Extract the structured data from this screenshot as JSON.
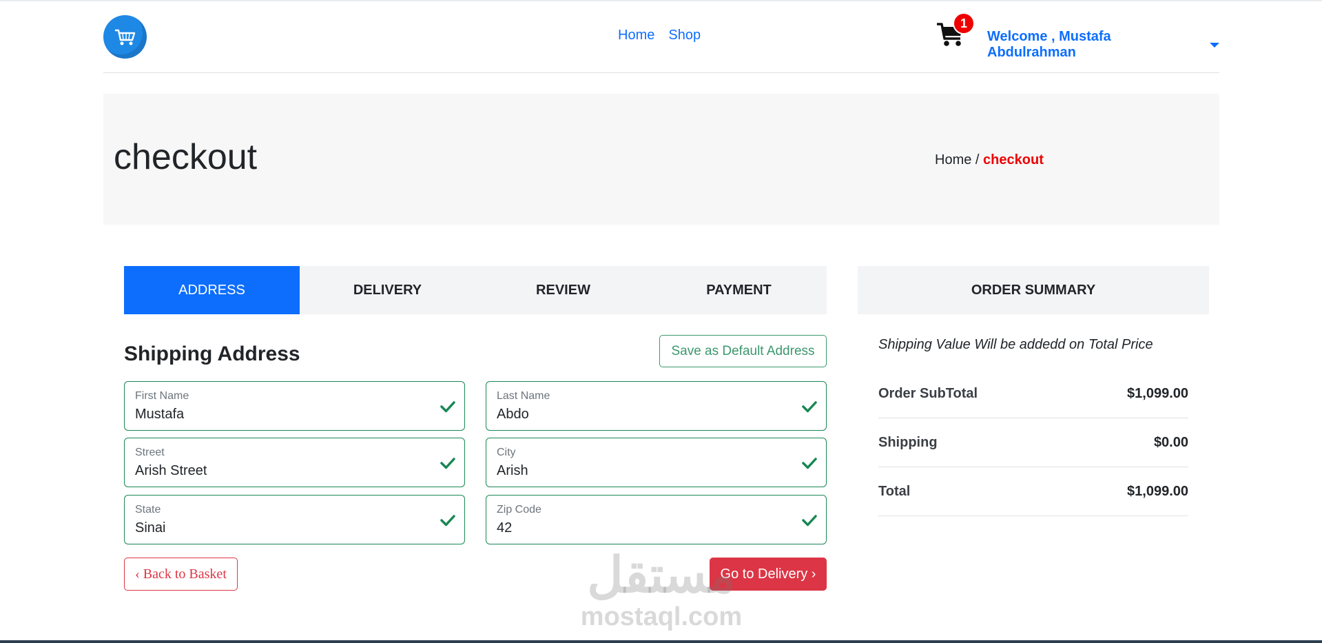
{
  "header": {
    "nav": [
      "Home",
      "Shop"
    ],
    "cart_count": "1",
    "welcome": "Welcome , Mustafa Abdulrahman"
  },
  "hero": {
    "title": "checkout",
    "breadcrumb_home": "Home",
    "breadcrumb_sep": "/",
    "breadcrumb_current": "checkout"
  },
  "tabs": [
    "ADDRESS",
    "DELIVERY",
    "REVIEW",
    "PAYMENT"
  ],
  "form": {
    "title": "Shipping Address",
    "save_default": "Save as Default Address",
    "fields": [
      {
        "label": "First Name",
        "value": "Mustafa"
      },
      {
        "label": "Last Name",
        "value": "Abdo"
      },
      {
        "label": "Street",
        "value": "Arish Street"
      },
      {
        "label": "City",
        "value": "Arish"
      },
      {
        "label": "State",
        "value": "Sinai"
      },
      {
        "label": "Zip Code",
        "value": "42"
      }
    ],
    "back": "‹ Back to Basket",
    "next": "Go to Delivery ›"
  },
  "summary": {
    "title": "ORDER SUMMARY",
    "note": "Shipping Value Will be addedd on Total Price",
    "rows": [
      {
        "label": "Order SubTotal",
        "value": "$1,099.00"
      },
      {
        "label": "Shipping",
        "value": "$0.00"
      },
      {
        "label": "Total",
        "value": "$1,099.00"
      }
    ]
  },
  "watermark": {
    "arabic": "مستقل",
    "latin": "mostaql.com"
  },
  "colors": {
    "primary": "#0d6efd",
    "success": "#198754",
    "danger": "#dc3545",
    "badge": "#ee0000"
  }
}
